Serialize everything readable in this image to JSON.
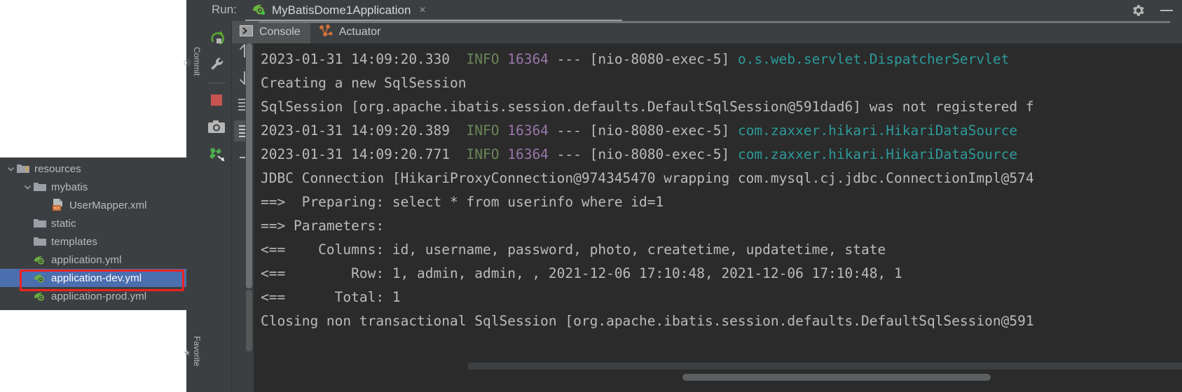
{
  "window": {
    "run_label": "Run:",
    "run_tab_title": "MyBatisDome1Application",
    "close_glyph": "×",
    "gear_icon": "gear-icon",
    "minimize_glyph": "—"
  },
  "subtabs": [
    {
      "label": "Console",
      "icon": "console-icon",
      "selected": true
    },
    {
      "label": "Actuator",
      "icon": "actuator-icon",
      "selected": false
    }
  ],
  "toolbar_left": [
    {
      "name": "rerun-button",
      "tooltip": "Rerun"
    },
    {
      "name": "settings-wrench-button",
      "tooltip": "Settings"
    },
    {
      "name": "stop-button",
      "tooltip": "Stop"
    },
    {
      "name": "screenshot-camera-button",
      "tooltip": "Screenshot"
    },
    {
      "name": "thread-dump-button",
      "tooltip": "Thread Dump"
    }
  ],
  "toolbar_secondary": [
    {
      "name": "up-arrow-button",
      "tooltip": "Up"
    },
    {
      "name": "down-arrow-button",
      "tooltip": "Down"
    },
    {
      "name": "soft-wrap-button",
      "tooltip": "Soft-Wrap"
    },
    {
      "name": "scroll-to-end-button",
      "tooltip": "Scroll to End",
      "active": true
    },
    {
      "name": "collapse-button",
      "tooltip": "Collapse"
    }
  ],
  "vertical_tabs": [
    {
      "label": "Commit",
      "name": "commit-tool-tab"
    },
    {
      "label": "Favorite",
      "name": "favorites-tool-tab"
    }
  ],
  "file_tree": [
    {
      "label": "resources",
      "indent": 0,
      "twisty": "down",
      "icon": "resources-folder-icon",
      "selected": false
    },
    {
      "label": "mybatis",
      "indent": 1,
      "twisty": "down",
      "icon": "folder-icon",
      "selected": false
    },
    {
      "label": "UserMapper.xml",
      "indent": 2,
      "twisty": "none",
      "icon": "xml-file-icon",
      "selected": false
    },
    {
      "label": "static",
      "indent": 1,
      "twisty": "none",
      "icon": "folder-icon",
      "selected": false
    },
    {
      "label": "templates",
      "indent": 1,
      "twisty": "none",
      "icon": "folder-icon",
      "selected": false
    },
    {
      "label": "application.yml",
      "indent": 1,
      "twisty": "none",
      "icon": "spring-yml-file-icon",
      "selected": false
    },
    {
      "label": "application-dev.yml",
      "indent": 1,
      "twisty": "none",
      "icon": "spring-yml-file-icon",
      "selected": true
    },
    {
      "label": "application-prod.yml",
      "indent": 1,
      "twisty": "none",
      "icon": "spring-yml-file-icon",
      "selected": false
    }
  ],
  "annotation": {
    "name": "red-highlight-box",
    "color": "#ee2222",
    "target": "application-dev.yml"
  },
  "console_lines": [
    {
      "segments": [
        {
          "text": "2023-01-31 14:09:20.330 ",
          "style": "plain"
        },
        {
          "text": " INFO",
          "style": "info"
        },
        {
          "text": " ",
          "style": "plain"
        },
        {
          "text": "16364",
          "style": "pid"
        },
        {
          "text": " --- [nio-8080-exec-5] ",
          "style": "plain"
        },
        {
          "text": "o.s.web.servlet.DispatcherServlet",
          "style": "class"
        }
      ]
    },
    {
      "segments": [
        {
          "text": "Creating a new SqlSession",
          "style": "plain"
        }
      ]
    },
    {
      "segments": [
        {
          "text": "SqlSession [org.apache.ibatis.session.defaults.DefaultSqlSession@591dad6] was not registered f",
          "style": "plain"
        }
      ]
    },
    {
      "segments": [
        {
          "text": "2023-01-31 14:09:20.389 ",
          "style": "plain"
        },
        {
          "text": " INFO",
          "style": "info"
        },
        {
          "text": " ",
          "style": "plain"
        },
        {
          "text": "16364",
          "style": "pid"
        },
        {
          "text": " --- [nio-8080-exec-5] ",
          "style": "plain"
        },
        {
          "text": "com.zaxxer.hikari.HikariDataSource",
          "style": "class"
        }
      ]
    },
    {
      "segments": [
        {
          "text": "2023-01-31 14:09:20.771 ",
          "style": "plain"
        },
        {
          "text": " INFO",
          "style": "info"
        },
        {
          "text": " ",
          "style": "plain"
        },
        {
          "text": "16364",
          "style": "pid"
        },
        {
          "text": " --- [nio-8080-exec-5] ",
          "style": "plain"
        },
        {
          "text": "com.zaxxer.hikari.HikariDataSource",
          "style": "class"
        }
      ]
    },
    {
      "segments": [
        {
          "text": "JDBC Connection [HikariProxyConnection@974345470 wrapping com.mysql.cj.jdbc.ConnectionImpl@574",
          "style": "plain"
        }
      ]
    },
    {
      "segments": [
        {
          "text": "==>  Preparing: select * from userinfo where id=1",
          "style": "plain"
        }
      ]
    },
    {
      "segments": [
        {
          "text": "==> Parameters:",
          "style": "plain"
        }
      ]
    },
    {
      "segments": [
        {
          "text": "<==    Columns: id, username, password, photo, createtime, updatetime, state",
          "style": "plain"
        }
      ]
    },
    {
      "segments": [
        {
          "text": "<==        Row: 1, admin, admin, , 2021-12-06 17:10:48, 2021-12-06 17:10:48, 1",
          "style": "plain"
        }
      ]
    },
    {
      "segments": [
        {
          "text": "<==      Total: 1",
          "style": "plain"
        }
      ]
    },
    {
      "segments": [
        {
          "text": "Closing non transactional SqlSession [org.apache.ibatis.session.defaults.DefaultSqlSession@591",
          "style": "plain"
        }
      ]
    }
  ],
  "colors": {
    "console_bg": "#2b2b2b",
    "ide_bg": "#3c3f41",
    "selection_blue": "#4b6eaf",
    "info_green": "#6a8759",
    "pid_purple": "#9876aa",
    "class_teal": "#2d9a9a",
    "text_grey": "#bbbbbb",
    "annotation_red": "#ee2222"
  }
}
